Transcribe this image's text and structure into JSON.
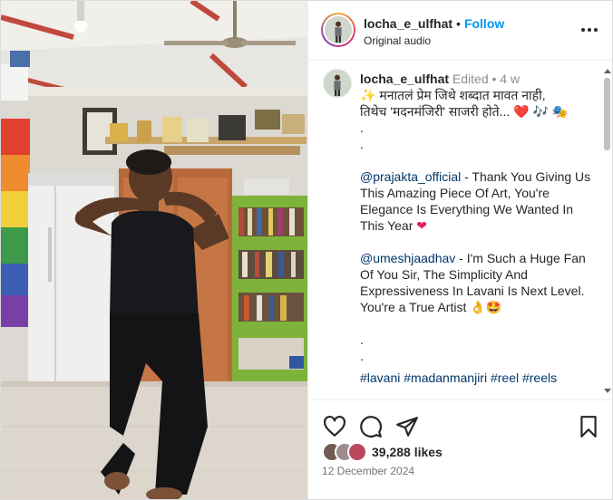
{
  "post": {
    "username": "locha_e_ulfhat",
    "separator": "•",
    "follow_label": "Follow",
    "audio_label": "Original audio"
  },
  "caption": {
    "username": "locha_e_ulfhat",
    "meta": "Edited • 4 w",
    "line1": "✨ मनातलं प्रेम जिथे शब्दात मावत नाही,",
    "line2": "तिथेच 'मदनमंजिरी' साजरी होते... ❤️ 🎶 🎭",
    "dot1": ".",
    "dot2": ".",
    "mention1": "@prajakta_official",
    "text1": " - Thank You Giving Us This Amazing Piece Of Art, You're Elegance Is Everything We Wanted In This Year ",
    "heart": "❤",
    "mention2": "@umeshjaadhav",
    "text2": " - I'm Such a Huge Fan Of You Sir, The Simplicity And Expressiveness In Lavani Is Next Level. You're a True Artist 👌🤩",
    "dot3": ".",
    "dot4": ".",
    "hashtags": "#lavani #madanmanjiri #reel #reels"
  },
  "stats": {
    "likes": "39,288 likes",
    "date": "12 December 2024"
  },
  "icons": {
    "like": "heart-icon",
    "comment": "comment-icon",
    "share": "share-icon",
    "save": "bookmark-icon",
    "more": "more-icon"
  },
  "colors": {
    "follow": "#0095f6",
    "link": "#00376b",
    "muted": "#737373"
  }
}
